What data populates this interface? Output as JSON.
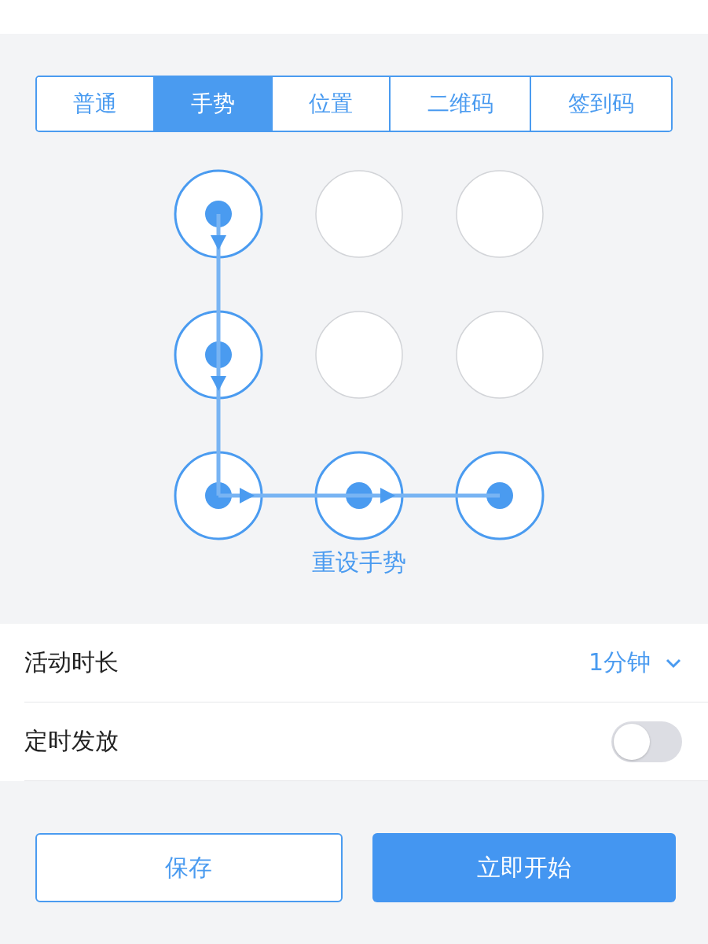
{
  "tabs": [
    {
      "label": "普通",
      "selected": false
    },
    {
      "label": "手势",
      "selected": true
    },
    {
      "label": "位置",
      "selected": false
    },
    {
      "label": "二维码",
      "selected": false
    },
    {
      "label": "签到码",
      "selected": false
    }
  ],
  "gesture": {
    "nodes": [
      {
        "selected": true,
        "link_down": true,
        "link_right": false
      },
      {
        "selected": false,
        "link_down": false,
        "link_right": false
      },
      {
        "selected": false,
        "link_down": false,
        "link_right": false
      },
      {
        "selected": true,
        "link_down": true,
        "link_right": false
      },
      {
        "selected": false,
        "link_down": false,
        "link_right": false
      },
      {
        "selected": false,
        "link_down": false,
        "link_right": false
      },
      {
        "selected": true,
        "link_down": false,
        "link_right": true
      },
      {
        "selected": true,
        "link_down": false,
        "link_right": true
      },
      {
        "selected": true,
        "link_down": false,
        "link_right": false
      }
    ],
    "reset_link": "重设手势"
  },
  "settings": [
    {
      "kind": "select",
      "label": "活动时长",
      "value": "1分钟"
    },
    {
      "kind": "toggle",
      "label": "定时发放",
      "on": false
    }
  ],
  "buttons": [
    {
      "kind": "secondary",
      "label": "保存"
    },
    {
      "kind": "primary",
      "label": "立即开始"
    }
  ]
}
